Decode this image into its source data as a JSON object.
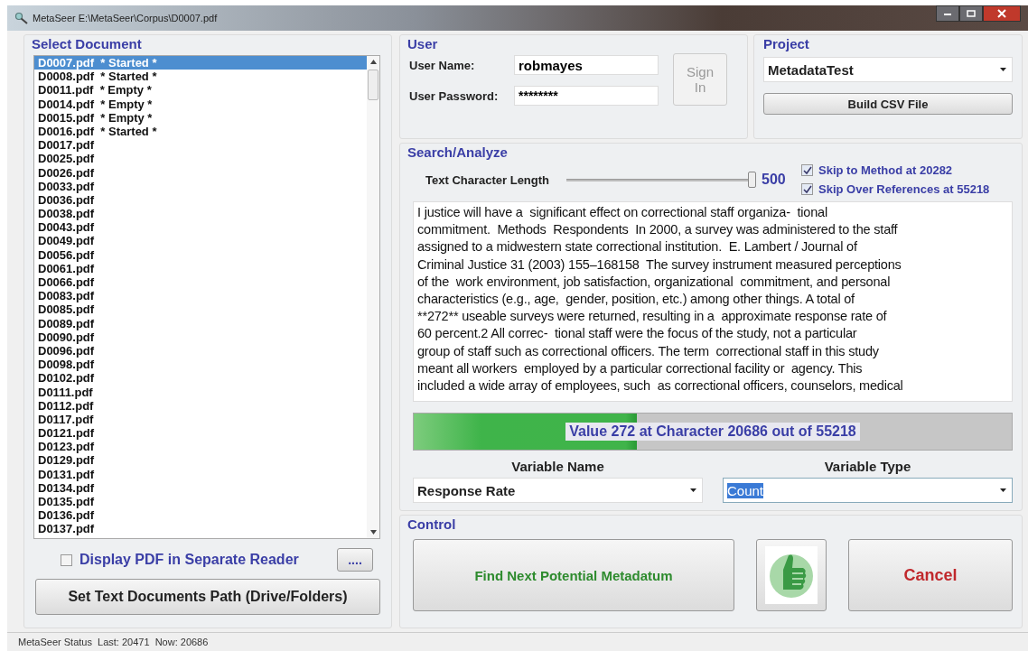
{
  "window": {
    "title": "MetaSeer E:\\MetaSeer\\Corpus\\D0007.pdf"
  },
  "select_document": {
    "title": "Select Document",
    "documents": [
      {
        "label": "D0007.pdf  * Started *",
        "selected": true
      },
      {
        "label": "D0008.pdf  * Started *",
        "selected": false
      },
      {
        "label": "D0011.pdf  * Empty *",
        "selected": false
      },
      {
        "label": "D0014.pdf  * Empty *",
        "selected": false
      },
      {
        "label": "D0015.pdf  * Empty *",
        "selected": false
      },
      {
        "label": "D0016.pdf  * Started *",
        "selected": false
      },
      {
        "label": "D0017.pdf",
        "selected": false
      },
      {
        "label": "D0025.pdf",
        "selected": false
      },
      {
        "label": "D0026.pdf",
        "selected": false
      },
      {
        "label": "D0033.pdf",
        "selected": false
      },
      {
        "label": "D0036.pdf",
        "selected": false
      },
      {
        "label": "D0038.pdf",
        "selected": false
      },
      {
        "label": "D0043.pdf",
        "selected": false
      },
      {
        "label": "D0049.pdf",
        "selected": false
      },
      {
        "label": "D0056.pdf",
        "selected": false
      },
      {
        "label": "D0061.pdf",
        "selected": false
      },
      {
        "label": "D0066.pdf",
        "selected": false
      },
      {
        "label": "D0083.pdf",
        "selected": false
      },
      {
        "label": "D0085.pdf",
        "selected": false
      },
      {
        "label": "D0089.pdf",
        "selected": false
      },
      {
        "label": "D0090.pdf",
        "selected": false
      },
      {
        "label": "D0096.pdf",
        "selected": false
      },
      {
        "label": "D0098.pdf",
        "selected": false
      },
      {
        "label": "D0102.pdf",
        "selected": false
      },
      {
        "label": "D0111.pdf",
        "selected": false
      },
      {
        "label": "D0112.pdf",
        "selected": false
      },
      {
        "label": "D0117.pdf",
        "selected": false
      },
      {
        "label": "D0121.pdf",
        "selected": false
      },
      {
        "label": "D0123.pdf",
        "selected": false
      },
      {
        "label": "D0129.pdf",
        "selected": false
      },
      {
        "label": "D0131.pdf",
        "selected": false
      },
      {
        "label": "D0134.pdf",
        "selected": false
      },
      {
        "label": "D0135.pdf",
        "selected": false
      },
      {
        "label": "D0136.pdf",
        "selected": false
      },
      {
        "label": "D0137.pdf",
        "selected": false
      }
    ],
    "separate_reader": {
      "label": "Display PDF in Separate Reader",
      "checked": false
    },
    "browse_button": "....",
    "path_button": "Set Text Documents Path (Drive/Folders)"
  },
  "user": {
    "title": "User",
    "name_label": "User Name:",
    "name_value": "robmayes",
    "password_label": "User Password:",
    "password_value": "********",
    "sign_in": {
      "label": "Sign In",
      "disabled": true
    }
  },
  "project": {
    "title": "Project",
    "value": "MetadataTest",
    "build_button": "Build CSV File"
  },
  "search": {
    "title": "Search/Analyze",
    "length_label": "Text Character Length",
    "length_slider": {
      "level": 1.0
    },
    "length_reading": "500",
    "options": [
      {
        "label": "Skip to Method at 20282",
        "checked": true
      },
      {
        "label": "Skip Over References at 55218",
        "checked": true
      }
    ],
    "text_lines": [
      "I justice will have a  significant effect on correctional staff organiza-  tional",
      "commitment.  Methods  Respondents  In 2000, a survey was administered to the staff",
      "assigned to a midwestern state correctional institution.  E. Lambert / Journal of",
      "Criminal Justice 31 (2003) 155–168158  The survey instrument measured perceptions",
      "of the  work environment, job satisfaction, organizational  commitment, and personal",
      "characteristics (e.g., age,  gender, position, etc.) among other things. A total of",
      "**272** useable surveys were returned, resulting in a  approximate response rate of",
      "60 percent.2 All correc-  tional staff were the focus of the study, not a particular",
      "group of staff such as correctional officers. The term  correctional staff in this study",
      "meant all workers  employed by a particular correctional facility or  agency. This",
      "included a wide array of employees, such  as correctional officers, counselors, medical"
    ],
    "progress": {
      "level": 0.373,
      "label": "Value 272 at Character 20686 out of 55218"
    },
    "variable_name": {
      "label": "Variable Name",
      "value": "Response Rate"
    },
    "variable_type": {
      "label": "Variable Type",
      "value": "Count"
    }
  },
  "control": {
    "title": "Control",
    "find_button": "Find Next Potential Metadatum",
    "cancel_button": "Cancel"
  },
  "status_bar": "MetaSeer Status  Last: 20471  Now: 20686"
}
